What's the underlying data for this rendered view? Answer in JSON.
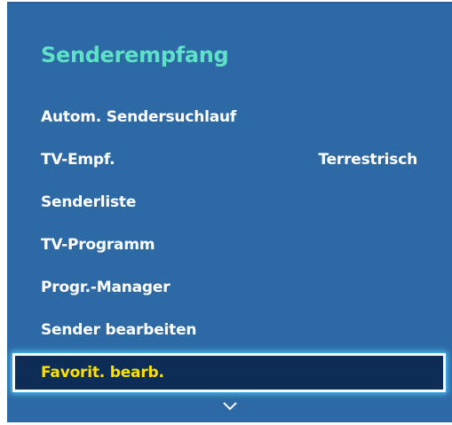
{
  "menu": {
    "title": "Senderempfang",
    "items": [
      {
        "label": "Autom. Sendersuchlauf",
        "value": ""
      },
      {
        "label": "TV-Empf.",
        "value": "Terrestrisch"
      },
      {
        "label": "Senderliste",
        "value": ""
      },
      {
        "label": "TV-Programm",
        "value": ""
      },
      {
        "label": "Progr.-Manager",
        "value": ""
      },
      {
        "label": "Sender bearbeiten",
        "value": ""
      },
      {
        "label": "Favorit. bearb.",
        "value": ""
      }
    ],
    "selected_index": 6,
    "scroll_indicator_icon": "chevron-down-icon"
  },
  "colors": {
    "panel_background": "#2d6aa5",
    "title_color": "#5fe0c8",
    "item_text": "#ffffff",
    "selected_background": "#0d2d57",
    "selected_text": "#ffe000",
    "highlight_border": "#f7fbff"
  }
}
